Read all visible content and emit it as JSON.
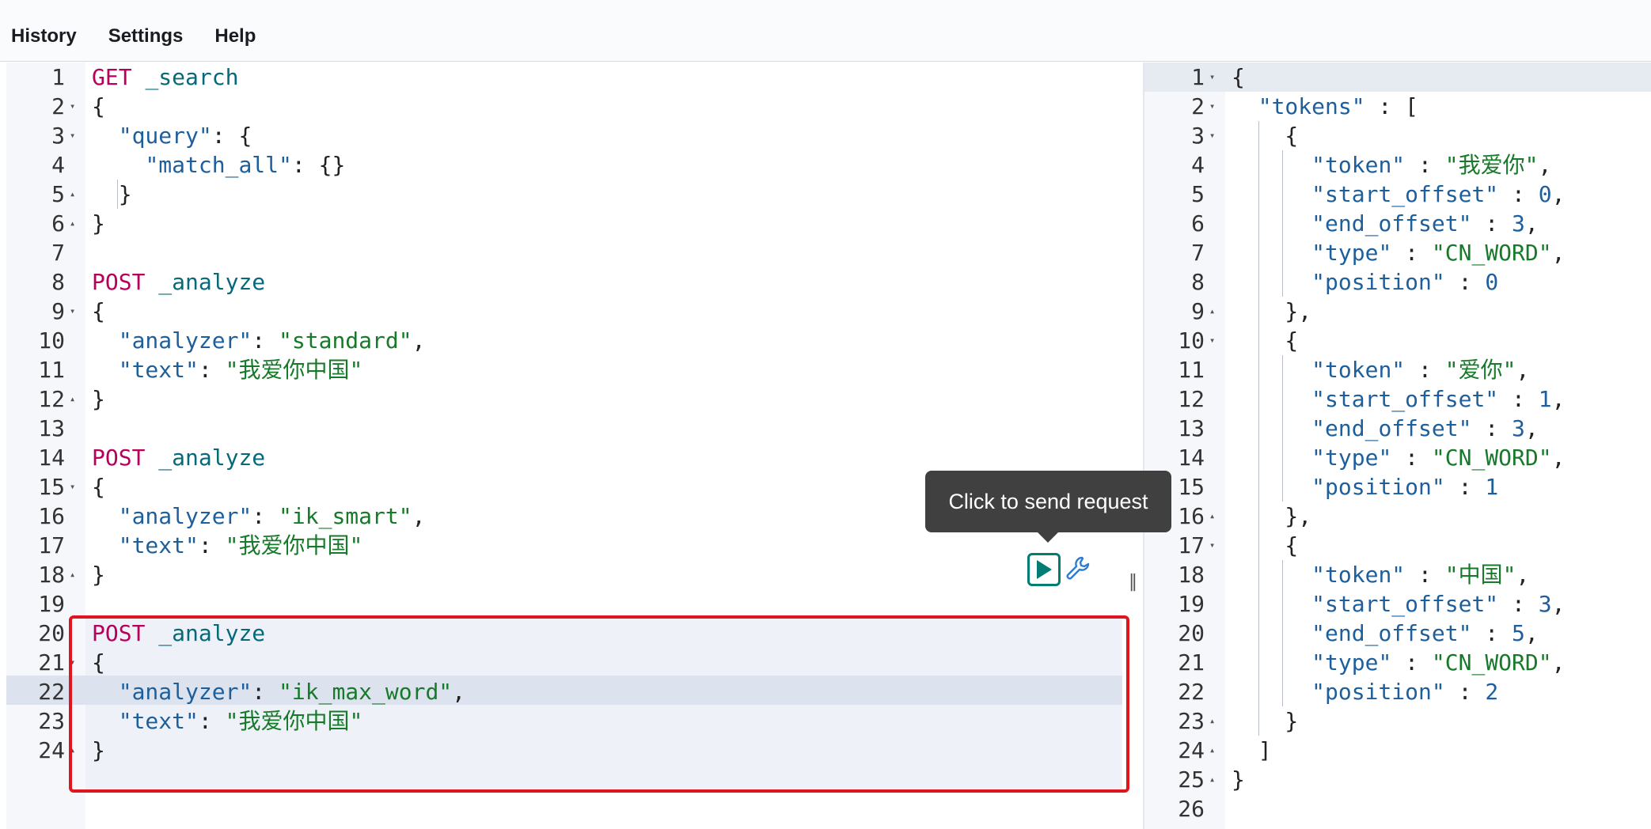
{
  "menu": {
    "history": "History",
    "settings": "Settings",
    "help": "Help"
  },
  "tooltip": "Click to send request",
  "icons": {
    "play": "play-icon",
    "wrench": "wrench-icon",
    "resize": "resize-handle-icon"
  },
  "colors": {
    "method": "#b5005c",
    "key": "#1d5f9c",
    "string": "#177a2a",
    "highlight_border": "#e0151e",
    "play_button": "#017d73"
  },
  "request_editor": {
    "lines": [
      {
        "n": "1",
        "fold": "",
        "tokens": [
          {
            "t": "method",
            "v": "GET"
          },
          {
            "t": "punc",
            "v": " "
          },
          {
            "t": "url",
            "v": "_search"
          }
        ]
      },
      {
        "n": "2",
        "fold": "▾",
        "tokens": [
          {
            "t": "punc",
            "v": "{"
          }
        ]
      },
      {
        "n": "3",
        "fold": "▾",
        "tokens": [
          {
            "t": "punc",
            "v": "  "
          },
          {
            "t": "key",
            "v": "\"query\""
          },
          {
            "t": "punc",
            "v": ": {"
          }
        ]
      },
      {
        "n": "4",
        "fold": "",
        "tokens": [
          {
            "t": "punc",
            "v": "    "
          },
          {
            "t": "key",
            "v": "\"match_all\""
          },
          {
            "t": "punc",
            "v": ": {}"
          }
        ]
      },
      {
        "n": "5",
        "fold": "▴",
        "tokens": [
          {
            "t": "punc",
            "v": "  }"
          }
        ]
      },
      {
        "n": "6",
        "fold": "▴",
        "tokens": [
          {
            "t": "punc",
            "v": "}"
          }
        ]
      },
      {
        "n": "7",
        "fold": "",
        "tokens": []
      },
      {
        "n": "8",
        "fold": "",
        "tokens": [
          {
            "t": "method",
            "v": "POST"
          },
          {
            "t": "punc",
            "v": " "
          },
          {
            "t": "url",
            "v": "_analyze"
          }
        ]
      },
      {
        "n": "9",
        "fold": "▾",
        "tokens": [
          {
            "t": "punc",
            "v": "{"
          }
        ]
      },
      {
        "n": "10",
        "fold": "",
        "tokens": [
          {
            "t": "punc",
            "v": "  "
          },
          {
            "t": "key",
            "v": "\"analyzer\""
          },
          {
            "t": "punc",
            "v": ": "
          },
          {
            "t": "str",
            "v": "\"standard\""
          },
          {
            "t": "punc",
            "v": ","
          }
        ]
      },
      {
        "n": "11",
        "fold": "",
        "tokens": [
          {
            "t": "punc",
            "v": "  "
          },
          {
            "t": "key",
            "v": "\"text\""
          },
          {
            "t": "punc",
            "v": ": "
          },
          {
            "t": "str",
            "v": "\"我爱你中国\""
          }
        ]
      },
      {
        "n": "12",
        "fold": "▴",
        "tokens": [
          {
            "t": "punc",
            "v": "}"
          }
        ]
      },
      {
        "n": "13",
        "fold": "",
        "tokens": []
      },
      {
        "n": "14",
        "fold": "",
        "tokens": [
          {
            "t": "method",
            "v": "POST"
          },
          {
            "t": "punc",
            "v": " "
          },
          {
            "t": "url",
            "v": "_analyze"
          }
        ]
      },
      {
        "n": "15",
        "fold": "▾",
        "tokens": [
          {
            "t": "punc",
            "v": "{"
          }
        ]
      },
      {
        "n": "16",
        "fold": "",
        "tokens": [
          {
            "t": "punc",
            "v": "  "
          },
          {
            "t": "key",
            "v": "\"analyzer\""
          },
          {
            "t": "punc",
            "v": ": "
          },
          {
            "t": "str",
            "v": "\"ik_smart\""
          },
          {
            "t": "punc",
            "v": ","
          }
        ]
      },
      {
        "n": "17",
        "fold": "",
        "tokens": [
          {
            "t": "punc",
            "v": "  "
          },
          {
            "t": "key",
            "v": "\"text\""
          },
          {
            "t": "punc",
            "v": ": "
          },
          {
            "t": "str",
            "v": "\"我爱你中国\""
          }
        ]
      },
      {
        "n": "18",
        "fold": "▴",
        "tokens": [
          {
            "t": "punc",
            "v": "}"
          }
        ]
      },
      {
        "n": "19",
        "fold": "",
        "tokens": []
      },
      {
        "n": "20",
        "fold": "",
        "tokens": [
          {
            "t": "method",
            "v": "POST"
          },
          {
            "t": "punc",
            "v": " "
          },
          {
            "t": "url",
            "v": "_analyze"
          }
        ]
      },
      {
        "n": "21",
        "fold": "▾",
        "tokens": [
          {
            "t": "punc",
            "v": "{"
          }
        ]
      },
      {
        "n": "22",
        "fold": "",
        "tokens": [
          {
            "t": "punc",
            "v": "  "
          },
          {
            "t": "key",
            "v": "\"analyzer\""
          },
          {
            "t": "punc",
            "v": ": "
          },
          {
            "t": "str",
            "v": "\"ik_max_word\""
          },
          {
            "t": "punc",
            "v": ","
          }
        ]
      },
      {
        "n": "23",
        "fold": "",
        "tokens": [
          {
            "t": "punc",
            "v": "  "
          },
          {
            "t": "key",
            "v": "\"text\""
          },
          {
            "t": "punc",
            "v": ": "
          },
          {
            "t": "str",
            "v": "\"我爱你中国\""
          }
        ]
      },
      {
        "n": "24",
        "fold": "▴",
        "tokens": [
          {
            "t": "punc",
            "v": "}"
          }
        ]
      }
    ]
  },
  "response_viewer": {
    "lines": [
      {
        "n": "1",
        "fold": "▾",
        "tokens": [
          {
            "t": "punc",
            "v": "{"
          }
        ]
      },
      {
        "n": "2",
        "fold": "▾",
        "tokens": [
          {
            "t": "punc",
            "v": "  "
          },
          {
            "t": "key",
            "v": "\"tokens\""
          },
          {
            "t": "punc",
            "v": " : ["
          }
        ]
      },
      {
        "n": "3",
        "fold": "▾",
        "tokens": [
          {
            "t": "punc",
            "v": "    {"
          }
        ]
      },
      {
        "n": "4",
        "fold": "",
        "tokens": [
          {
            "t": "punc",
            "v": "      "
          },
          {
            "t": "key",
            "v": "\"token\""
          },
          {
            "t": "punc",
            "v": " : "
          },
          {
            "t": "str",
            "v": "\"我爱你\""
          },
          {
            "t": "punc",
            "v": ","
          }
        ]
      },
      {
        "n": "5",
        "fold": "",
        "tokens": [
          {
            "t": "punc",
            "v": "      "
          },
          {
            "t": "key",
            "v": "\"start_offset\""
          },
          {
            "t": "punc",
            "v": " : "
          },
          {
            "t": "num",
            "v": "0"
          },
          {
            "t": "punc",
            "v": ","
          }
        ]
      },
      {
        "n": "6",
        "fold": "",
        "tokens": [
          {
            "t": "punc",
            "v": "      "
          },
          {
            "t": "key",
            "v": "\"end_offset\""
          },
          {
            "t": "punc",
            "v": " : "
          },
          {
            "t": "num",
            "v": "3"
          },
          {
            "t": "punc",
            "v": ","
          }
        ]
      },
      {
        "n": "7",
        "fold": "",
        "tokens": [
          {
            "t": "punc",
            "v": "      "
          },
          {
            "t": "key",
            "v": "\"type\""
          },
          {
            "t": "punc",
            "v": " : "
          },
          {
            "t": "str",
            "v": "\"CN_WORD\""
          },
          {
            "t": "punc",
            "v": ","
          }
        ]
      },
      {
        "n": "8",
        "fold": "",
        "tokens": [
          {
            "t": "punc",
            "v": "      "
          },
          {
            "t": "key",
            "v": "\"position\""
          },
          {
            "t": "punc",
            "v": " : "
          },
          {
            "t": "num",
            "v": "0"
          }
        ]
      },
      {
        "n": "9",
        "fold": "▴",
        "tokens": [
          {
            "t": "punc",
            "v": "    },"
          }
        ]
      },
      {
        "n": "10",
        "fold": "▾",
        "tokens": [
          {
            "t": "punc",
            "v": "    {"
          }
        ]
      },
      {
        "n": "11",
        "fold": "",
        "tokens": [
          {
            "t": "punc",
            "v": "      "
          },
          {
            "t": "key",
            "v": "\"token\""
          },
          {
            "t": "punc",
            "v": " : "
          },
          {
            "t": "str",
            "v": "\"爱你\""
          },
          {
            "t": "punc",
            "v": ","
          }
        ]
      },
      {
        "n": "12",
        "fold": "",
        "tokens": [
          {
            "t": "punc",
            "v": "      "
          },
          {
            "t": "key",
            "v": "\"start_offset\""
          },
          {
            "t": "punc",
            "v": " : "
          },
          {
            "t": "num",
            "v": "1"
          },
          {
            "t": "punc",
            "v": ","
          }
        ]
      },
      {
        "n": "13",
        "fold": "",
        "tokens": [
          {
            "t": "punc",
            "v": "      "
          },
          {
            "t": "key",
            "v": "\"end_offset\""
          },
          {
            "t": "punc",
            "v": " : "
          },
          {
            "t": "num",
            "v": "3"
          },
          {
            "t": "punc",
            "v": ","
          }
        ]
      },
      {
        "n": "14",
        "fold": "",
        "tokens": [
          {
            "t": "punc",
            "v": "      "
          },
          {
            "t": "key",
            "v": "\"type\""
          },
          {
            "t": "punc",
            "v": " : "
          },
          {
            "t": "str",
            "v": "\"CN_WORD\""
          },
          {
            "t": "punc",
            "v": ","
          }
        ]
      },
      {
        "n": "15",
        "fold": "",
        "tokens": [
          {
            "t": "punc",
            "v": "      "
          },
          {
            "t": "key",
            "v": "\"position\""
          },
          {
            "t": "punc",
            "v": " : "
          },
          {
            "t": "num",
            "v": "1"
          }
        ]
      },
      {
        "n": "16",
        "fold": "▴",
        "tokens": [
          {
            "t": "punc",
            "v": "    },"
          }
        ]
      },
      {
        "n": "17",
        "fold": "▾",
        "tokens": [
          {
            "t": "punc",
            "v": "    {"
          }
        ]
      },
      {
        "n": "18",
        "fold": "",
        "tokens": [
          {
            "t": "punc",
            "v": "      "
          },
          {
            "t": "key",
            "v": "\"token\""
          },
          {
            "t": "punc",
            "v": " : "
          },
          {
            "t": "str",
            "v": "\"中国\""
          },
          {
            "t": "punc",
            "v": ","
          }
        ]
      },
      {
        "n": "19",
        "fold": "",
        "tokens": [
          {
            "t": "punc",
            "v": "      "
          },
          {
            "t": "key",
            "v": "\"start_offset\""
          },
          {
            "t": "punc",
            "v": " : "
          },
          {
            "t": "num",
            "v": "3"
          },
          {
            "t": "punc",
            "v": ","
          }
        ]
      },
      {
        "n": "20",
        "fold": "",
        "tokens": [
          {
            "t": "punc",
            "v": "      "
          },
          {
            "t": "key",
            "v": "\"end_offset\""
          },
          {
            "t": "punc",
            "v": " : "
          },
          {
            "t": "num",
            "v": "5"
          },
          {
            "t": "punc",
            "v": ","
          }
        ]
      },
      {
        "n": "21",
        "fold": "",
        "tokens": [
          {
            "t": "punc",
            "v": "      "
          },
          {
            "t": "key",
            "v": "\"type\""
          },
          {
            "t": "punc",
            "v": " : "
          },
          {
            "t": "str",
            "v": "\"CN_WORD\""
          },
          {
            "t": "punc",
            "v": ","
          }
        ]
      },
      {
        "n": "22",
        "fold": "",
        "tokens": [
          {
            "t": "punc",
            "v": "      "
          },
          {
            "t": "key",
            "v": "\"position\""
          },
          {
            "t": "punc",
            "v": " : "
          },
          {
            "t": "num",
            "v": "2"
          }
        ]
      },
      {
        "n": "23",
        "fold": "▴",
        "tokens": [
          {
            "t": "punc",
            "v": "    }"
          }
        ]
      },
      {
        "n": "24",
        "fold": "▴",
        "tokens": [
          {
            "t": "punc",
            "v": "  ]"
          }
        ]
      },
      {
        "n": "25",
        "fold": "▴",
        "tokens": [
          {
            "t": "punc",
            "v": "}"
          }
        ]
      },
      {
        "n": "26",
        "fold": "",
        "tokens": []
      }
    ]
  }
}
